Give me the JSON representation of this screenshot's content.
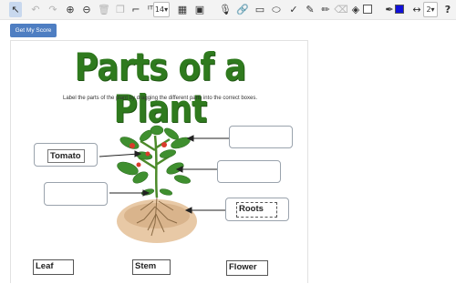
{
  "toolbar": {
    "font_size": "14",
    "line_width": "2",
    "help": "?",
    "fill_color": "#ffffff",
    "line_color": "#1010d8",
    "tools": [
      {
        "name": "pointer-tool",
        "icon": "pointer-icon",
        "glyph": "↖",
        "active": true
      },
      {
        "name": "undo-tool",
        "icon": "undo-icon",
        "glyph": "↶",
        "dim": true
      },
      {
        "name": "redo-tool",
        "icon": "redo-icon",
        "glyph": "↷",
        "dim": true
      },
      {
        "name": "zoom-in-tool",
        "icon": "zoom-in-icon",
        "glyph": "⊕"
      },
      {
        "name": "zoom-out-tool",
        "icon": "zoom-out-icon",
        "glyph": "⊖"
      },
      {
        "name": "delete-tool",
        "icon": "trash-icon",
        "glyph": "🗑",
        "dim": true
      },
      {
        "name": "copy-tool",
        "icon": "copy-icon",
        "glyph": "❐",
        "dim": true
      },
      {
        "name": "crop-tool",
        "icon": "crop-icon",
        "glyph": "⌐"
      },
      {
        "name": "text-tool",
        "icon": "text-size-icon",
        "glyph": "ᴵᵀ"
      },
      {
        "name": "table-tool",
        "icon": "table-icon",
        "glyph": "▦"
      },
      {
        "name": "image-tool",
        "icon": "image-icon",
        "glyph": "▣"
      },
      {
        "name": "microphone-tool",
        "icon": "microphone-icon",
        "glyph": "🎙"
      },
      {
        "name": "link-tool",
        "icon": "link-icon",
        "glyph": "🔗"
      },
      {
        "name": "rectangle-tool",
        "icon": "rectangle-icon",
        "glyph": "▭"
      },
      {
        "name": "ellipse-tool",
        "icon": "ellipse-icon",
        "glyph": "⬭"
      },
      {
        "name": "check-tool",
        "icon": "check-pen-icon",
        "glyph": "✓"
      },
      {
        "name": "highlighter-tool",
        "icon": "highlighter-icon",
        "glyph": "✎"
      },
      {
        "name": "pen-tool",
        "icon": "pen-icon",
        "glyph": "✏"
      },
      {
        "name": "eraser-tool",
        "icon": "eraser-icon",
        "glyph": "⌫",
        "dim": true
      },
      {
        "name": "fill-tool",
        "icon": "fill-bucket-icon",
        "glyph": "◈"
      },
      {
        "name": "line-color-tool",
        "icon": "marker-icon",
        "glyph": "✒"
      },
      {
        "name": "line-width-tool",
        "icon": "line-width-icon",
        "glyph": "↔"
      }
    ]
  },
  "score_button": "Get My Score",
  "worksheet": {
    "title": "Parts of a Plant",
    "instructions": "Label the parts of the plant by dragging the different parts into the correct boxes.",
    "placed_labels": {
      "tomato": "Tomato",
      "roots": "Roots"
    },
    "bank_labels": {
      "leaf": "Leaf",
      "stem": "Stem",
      "flower": "Flower"
    }
  }
}
